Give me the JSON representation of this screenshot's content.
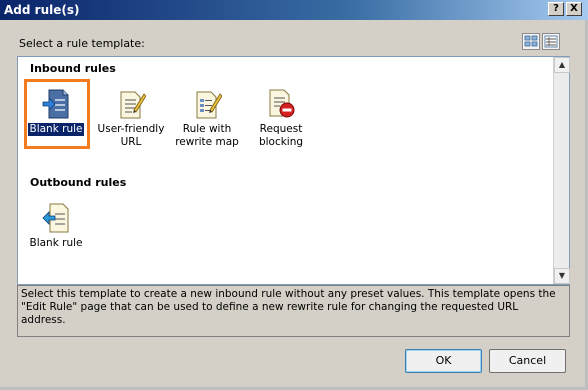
{
  "window": {
    "title": "Add rule(s)",
    "help_glyph": "?",
    "close_glyph": "X"
  },
  "dialog": {
    "select_label": "Select a rule template:",
    "view_buttons": [
      {
        "icon": "tiles-view-icon"
      },
      {
        "icon": "details-view-icon"
      }
    ],
    "inbound_header": "Inbound rules",
    "outbound_header": "Outbound rules",
    "inbound_items": [
      {
        "label": "Blank rule",
        "icon": "blank-rule-icon",
        "selected": true
      },
      {
        "label": "User-friendly URL",
        "icon": "user-friendly-url-icon"
      },
      {
        "label": "Rule with rewrite map",
        "icon": "rewrite-map-icon"
      },
      {
        "label": "Request blocking",
        "icon": "request-blocking-icon"
      }
    ],
    "outbound_items": [
      {
        "label": "Blank rule",
        "icon": "blank-outbound-rule-icon"
      }
    ],
    "description": "Select this template to create a new inbound rule without any preset values. This template opens the \"Edit Rule\" page that can be used to define a new rewrite rule for changing the requested URL address.",
    "ok_label": "OK",
    "cancel_label": "Cancel"
  },
  "colors": {
    "highlight_outline": "#f47c20",
    "selected_label_bg": "#0a246a",
    "titlebar": "#0a246a"
  }
}
